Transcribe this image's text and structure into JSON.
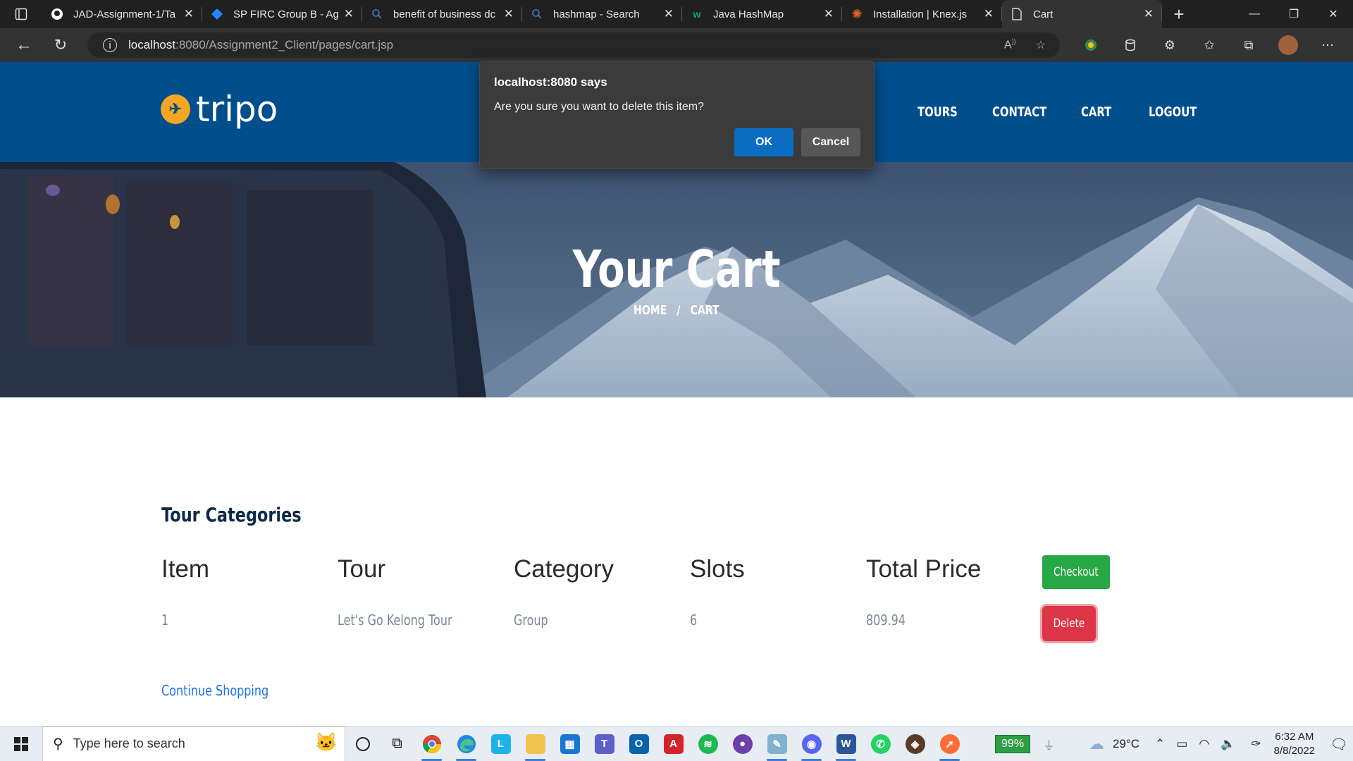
{
  "browser": {
    "tabs": [
      {
        "title": "JAD-Assignment-1/Ta",
        "icon": "github-icon"
      },
      {
        "title": "SP FIRC Group B - Agi",
        "icon": "jira-icon"
      },
      {
        "title": "benefit of business dc",
        "icon": "search-icon"
      },
      {
        "title": "hashmap - Search",
        "icon": "search-icon"
      },
      {
        "title": "Java HashMap",
        "icon": "w3schools-icon"
      },
      {
        "title": "Installation | Knex.js",
        "icon": "knex-icon"
      },
      {
        "title": "Cart",
        "icon": "page-icon",
        "active": true
      }
    ],
    "url_host": "localhost",
    "url_path": ":8080/Assignment2_Client/pages/cart.jsp"
  },
  "site": {
    "logo_text": "tripo",
    "nav": [
      "TOURS",
      "CONTACT",
      "CART",
      "LOGOUT"
    ],
    "nav_partial": "E"
  },
  "hero": {
    "title": "Your Cart",
    "breadcrumb_home": "HOME",
    "breadcrumb_sep": "/",
    "breadcrumb_current": "CART"
  },
  "cart": {
    "section_title": "Tour Categories",
    "headers": [
      "Item",
      "Tour",
      "Category",
      "Slots",
      "Total Price"
    ],
    "rows": [
      {
        "item": "1",
        "tour": "Let's Go Kelong Tour",
        "category": "Group",
        "slots": "6",
        "total_price": "809.94"
      }
    ],
    "checkout_label": "Checkout",
    "delete_label": "Delete",
    "continue_label": "Continue Shopping"
  },
  "dialog": {
    "title": "localhost:8080 says",
    "message": "Are you sure you want to delete this item?",
    "ok_label": "OK",
    "cancel_label": "Cancel"
  },
  "taskbar": {
    "search_placeholder": "Type here to search",
    "battery": "99%",
    "temperature": "29°C",
    "time": "6:32 AM",
    "date": "8/8/2022"
  },
  "colors": {
    "header_bg": "#004e8c",
    "logo_accent": "#f5a623",
    "checkout_green": "#28a745",
    "delete_red": "#dc3545",
    "link_blue": "#1a73e8",
    "dialog_ok_blue": "#0b6dc2"
  }
}
